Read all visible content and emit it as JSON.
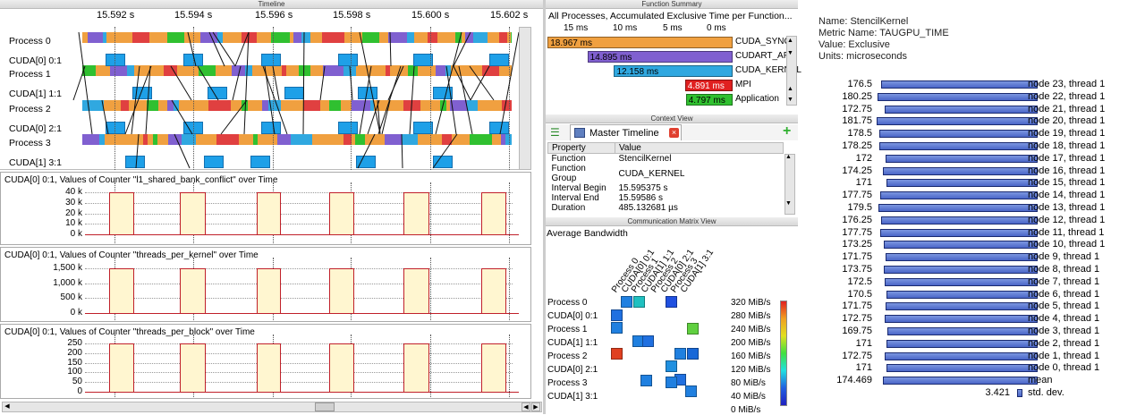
{
  "timeline": {
    "header": "Timeline",
    "ticks": [
      "15.592 s",
      "15.594 s",
      "15.596 s",
      "15.598 s",
      "15.600 s",
      "15.602 s"
    ],
    "rows": [
      "Process 0",
      "CUDA[0] 0:1",
      "Process 1",
      "CUDA[1] 1:1",
      "Process 2",
      "CUDA[0] 2:1",
      "Process 3",
      "CUDA[1] 3:1"
    ]
  },
  "counters": [
    {
      "title": "CUDA[0] 0:1, Values of Counter \"l1_shared_bank_conflict\" over Time",
      "ticks": [
        "40 k",
        "30 k",
        "20 k",
        "10 k",
        "0 k"
      ]
    },
    {
      "title": "CUDA[0] 0:1, Values of Counter \"threads_per_kernel\" over Time",
      "ticks": [
        "1,500 k",
        "1,000 k",
        "500 k",
        "0 k"
      ]
    },
    {
      "title": "CUDA[0] 0:1, Values of Counter \"threads_per_block\" over Time",
      "ticks": [
        "250",
        "200",
        "150",
        "100",
        "50",
        "0"
      ]
    }
  ],
  "function_summary": {
    "header": "Function Summary",
    "title": "All Processes, Accumulated Exclusive Time per Function...",
    "axis": [
      "15 ms",
      "10 ms",
      "5 ms",
      "0 ms"
    ],
    "rows": [
      {
        "label": "CUDA_SYNC",
        "value": "18.967 ms",
        "ms": 18.967,
        "color": "#f0a040"
      },
      {
        "label": "CUDART_API",
        "value": "14.895 ms",
        "ms": 14.895,
        "color": "#8060d0"
      },
      {
        "label": "CUDA_KERNEL",
        "value": "12.158 ms",
        "ms": 12.158,
        "color": "#30a8e0"
      },
      {
        "label": "MPI",
        "value": "4.891 ms",
        "ms": 4.891,
        "color": "#e02020"
      },
      {
        "label": "Application",
        "value": "4.797 ms",
        "ms": 4.797,
        "color": "#30c030"
      }
    ]
  },
  "context_view": {
    "header": "Context View",
    "tab": "Master Timeline",
    "col_property": "Property",
    "col_value": "Value",
    "rows": [
      {
        "k": "Function",
        "v": "StencilKernel"
      },
      {
        "k": "Function Group",
        "v": "CUDA_KERNEL"
      },
      {
        "k": "Interval Begin",
        "v": "15.595375 s"
      },
      {
        "k": "Interval End",
        "v": "15.59586 s"
      },
      {
        "k": "Duration",
        "v": "485.132681 µs"
      }
    ]
  },
  "comm_matrix": {
    "header": "Communication Matrix View",
    "title": "Average Bandwidth",
    "labels": [
      "Process 0",
      "CUDA[0] 0:1",
      "Process 1",
      "CUDA[1] 1:1",
      "Process 2",
      "CUDA[0] 2:1",
      "Process 3",
      "CUDA[1] 3:1"
    ],
    "scale": [
      "320 MiB/s",
      "280 MiB/s",
      "240 MiB/s",
      "200 MiB/s",
      "160 MiB/s",
      "120 MiB/s",
      "80 MiB/s",
      "40 MiB/s",
      "0 MiB/s"
    ]
  },
  "profile": {
    "name": "Name: StencilKernel",
    "metric": "Metric Name: TAUGPU_TIME",
    "value": "Value: Exclusive",
    "units": "Units: microseconds",
    "rows": [
      {
        "v": "176.5",
        "n": 176.5,
        "l": "node 23, thread 1"
      },
      {
        "v": "180.25",
        "n": 180.25,
        "l": "node 22, thread 1"
      },
      {
        "v": "172.75",
        "n": 172.75,
        "l": "node 21, thread 1"
      },
      {
        "v": "181.75",
        "n": 181.75,
        "l": "node 20, thread 1"
      },
      {
        "v": "178.5",
        "n": 178.5,
        "l": "node 19, thread 1"
      },
      {
        "v": "178.25",
        "n": 178.25,
        "l": "node 18, thread 1"
      },
      {
        "v": "172",
        "n": 172,
        "l": "node 17, thread 1"
      },
      {
        "v": "174.25",
        "n": 174.25,
        "l": "node 16, thread 1"
      },
      {
        "v": "171",
        "n": 171,
        "l": "node 15, thread 1"
      },
      {
        "v": "177.75",
        "n": 177.75,
        "l": "node 14, thread 1"
      },
      {
        "v": "179.5",
        "n": 179.5,
        "l": "node 13, thread 1"
      },
      {
        "v": "176.25",
        "n": 176.25,
        "l": "node 12, thread 1"
      },
      {
        "v": "177.75",
        "n": 177.75,
        "l": "node 11, thread 1"
      },
      {
        "v": "173.25",
        "n": 173.25,
        "l": "node 10, thread 1"
      },
      {
        "v": "171.75",
        "n": 171.75,
        "l": "node 9, thread 1"
      },
      {
        "v": "173.75",
        "n": 173.75,
        "l": "node 8, thread 1"
      },
      {
        "v": "172.5",
        "n": 172.5,
        "l": "node 7, thread 1"
      },
      {
        "v": "170.5",
        "n": 170.5,
        "l": "node 6, thread 1"
      },
      {
        "v": "171.75",
        "n": 171.75,
        "l": "node 5, thread 1"
      },
      {
        "v": "172.75",
        "n": 172.75,
        "l": "node 4, thread 1"
      },
      {
        "v": "169.75",
        "n": 169.75,
        "l": "node 3, thread 1"
      },
      {
        "v": "171",
        "n": 171,
        "l": "node 2, thread 1"
      },
      {
        "v": "172.75",
        "n": 172.75,
        "l": "node 1, thread 1"
      },
      {
        "v": "171",
        "n": 171,
        "l": "node 0, thread 1"
      },
      {
        "v": "174.469",
        "n": 174.469,
        "l": "mean"
      },
      {
        "v": "3.421",
        "n": 3.421,
        "l": "std. dev."
      }
    ]
  }
}
